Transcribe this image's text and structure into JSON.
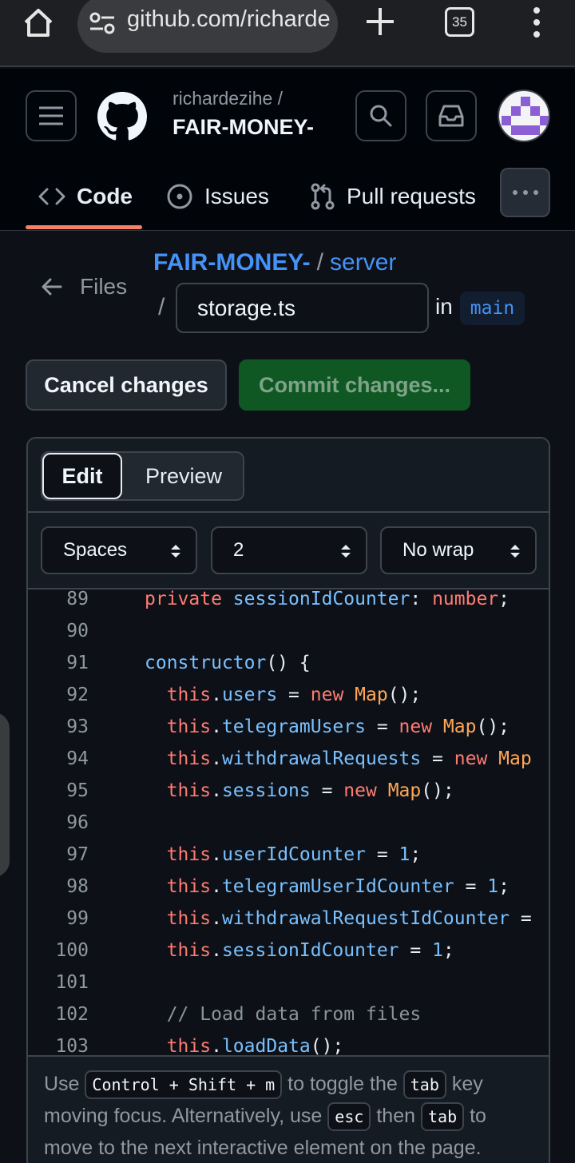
{
  "browser": {
    "url": "github.com/richarde",
    "tab_count": "35",
    "icons": [
      "home-icon",
      "site-settings-icon",
      "new-tab-icon",
      "tab-switcher-icon",
      "more-vert-icon"
    ]
  },
  "header": {
    "owner": "richardezihe /",
    "repo": "FAIR-MONEY-",
    "tabs": [
      {
        "label": "Code",
        "icon": "code-icon",
        "active": true
      },
      {
        "label": "Issues",
        "icon": "issue-opened-icon"
      },
      {
        "label": "Pull requests",
        "icon": "git-pull-request-icon"
      }
    ]
  },
  "breadcrumb": {
    "back_label": "Files",
    "repo": "FAIR-MONEY-",
    "separator": "/",
    "dir": "server",
    "slash": "/",
    "filename": "storage.ts",
    "in_label": "in",
    "branch": "main"
  },
  "actions": {
    "cancel": "Cancel changes",
    "commit": "Commit changes..."
  },
  "editor": {
    "mode_tabs": {
      "edit": "Edit",
      "preview": "Preview"
    },
    "indent_mode": "Spaces",
    "indent_size": "2",
    "wrap_mode": "No wrap",
    "lines": [
      {
        "n": "89",
        "tokens": [
          {
            "t": "kw",
            "v": "private"
          },
          {
            "t": "",
            "v": " "
          },
          {
            "t": "prop",
            "v": "sessionIdCounter"
          },
          {
            "t": "",
            "v": ": "
          },
          {
            "t": "kw",
            "v": "number"
          },
          {
            "t": "",
            "v": ";"
          }
        ]
      },
      {
        "n": "90",
        "tokens": []
      },
      {
        "n": "91",
        "tokens": [
          {
            "t": "prop",
            "v": "constructor"
          },
          {
            "t": "",
            "v": "() {"
          }
        ]
      },
      {
        "n": "92",
        "tokens": [
          {
            "t": "",
            "v": "  "
          },
          {
            "t": "kw",
            "v": "this"
          },
          {
            "t": "",
            "v": "."
          },
          {
            "t": "prop",
            "v": "users"
          },
          {
            "t": "",
            "v": " = "
          },
          {
            "t": "kw",
            "v": "new"
          },
          {
            "t": "",
            "v": " "
          },
          {
            "t": "cls",
            "v": "Map"
          },
          {
            "t": "",
            "v": "();"
          }
        ]
      },
      {
        "n": "93",
        "tokens": [
          {
            "t": "",
            "v": "  "
          },
          {
            "t": "kw",
            "v": "this"
          },
          {
            "t": "",
            "v": "."
          },
          {
            "t": "prop",
            "v": "telegramUsers"
          },
          {
            "t": "",
            "v": " = "
          },
          {
            "t": "kw",
            "v": "new"
          },
          {
            "t": "",
            "v": " "
          },
          {
            "t": "cls",
            "v": "Map"
          },
          {
            "t": "",
            "v": "();"
          }
        ]
      },
      {
        "n": "94",
        "tokens": [
          {
            "t": "",
            "v": "  "
          },
          {
            "t": "kw",
            "v": "this"
          },
          {
            "t": "",
            "v": "."
          },
          {
            "t": "prop",
            "v": "withdrawalRequests"
          },
          {
            "t": "",
            "v": " = "
          },
          {
            "t": "kw",
            "v": "new"
          },
          {
            "t": "",
            "v": " "
          },
          {
            "t": "cls",
            "v": "Map"
          }
        ]
      },
      {
        "n": "95",
        "tokens": [
          {
            "t": "",
            "v": "  "
          },
          {
            "t": "kw",
            "v": "this"
          },
          {
            "t": "",
            "v": "."
          },
          {
            "t": "prop",
            "v": "sessions"
          },
          {
            "t": "",
            "v": " = "
          },
          {
            "t": "kw",
            "v": "new"
          },
          {
            "t": "",
            "v": " "
          },
          {
            "t": "cls",
            "v": "Map"
          },
          {
            "t": "",
            "v": "();"
          }
        ]
      },
      {
        "n": "96",
        "tokens": []
      },
      {
        "n": "97",
        "tokens": [
          {
            "t": "",
            "v": "  "
          },
          {
            "t": "kw",
            "v": "this"
          },
          {
            "t": "",
            "v": "."
          },
          {
            "t": "prop",
            "v": "userIdCounter"
          },
          {
            "t": "",
            "v": " = "
          },
          {
            "t": "num",
            "v": "1"
          },
          {
            "t": "",
            "v": ";"
          }
        ]
      },
      {
        "n": "98",
        "tokens": [
          {
            "t": "",
            "v": "  "
          },
          {
            "t": "kw",
            "v": "this"
          },
          {
            "t": "",
            "v": "."
          },
          {
            "t": "prop",
            "v": "telegramUserIdCounter"
          },
          {
            "t": "",
            "v": " = "
          },
          {
            "t": "num",
            "v": "1"
          },
          {
            "t": "",
            "v": ";"
          }
        ]
      },
      {
        "n": "99",
        "tokens": [
          {
            "t": "",
            "v": "  "
          },
          {
            "t": "kw",
            "v": "this"
          },
          {
            "t": "",
            "v": "."
          },
          {
            "t": "prop",
            "v": "withdrawalRequestIdCounter"
          },
          {
            "t": "",
            "v": " ="
          }
        ]
      },
      {
        "n": "100",
        "tokens": [
          {
            "t": "",
            "v": "  "
          },
          {
            "t": "kw",
            "v": "this"
          },
          {
            "t": "",
            "v": "."
          },
          {
            "t": "prop",
            "v": "sessionIdCounter"
          },
          {
            "t": "",
            "v": " = "
          },
          {
            "t": "num",
            "v": "1"
          },
          {
            "t": "",
            "v": ";"
          }
        ]
      },
      {
        "n": "101",
        "tokens": []
      },
      {
        "n": "102",
        "tokens": [
          {
            "t": "",
            "v": "  "
          },
          {
            "t": "cmt",
            "v": "// Load data from files"
          }
        ]
      },
      {
        "n": "103",
        "tokens": [
          {
            "t": "",
            "v": "  "
          },
          {
            "t": "kw",
            "v": "this"
          },
          {
            "t": "",
            "v": "."
          },
          {
            "t": "prop",
            "v": "loadData"
          },
          {
            "t": "",
            "v": "();"
          }
        ]
      }
    ]
  },
  "help": {
    "use": "Use",
    "shortcut": "Control + Shift + m",
    "to_toggle": "to toggle the",
    "tab_key": "tab",
    "key_moving": "key moving focus. Alternatively, use",
    "esc_key": "esc",
    "then": "then",
    "tab_key2": "tab",
    "to_move": "to move to the next interactive element on the page."
  },
  "colors": {
    "background": "#0d1117",
    "header_bg": "#010409",
    "link": "#4493f8",
    "commit_green": "#105823",
    "tab_underline": "#f78166"
  }
}
